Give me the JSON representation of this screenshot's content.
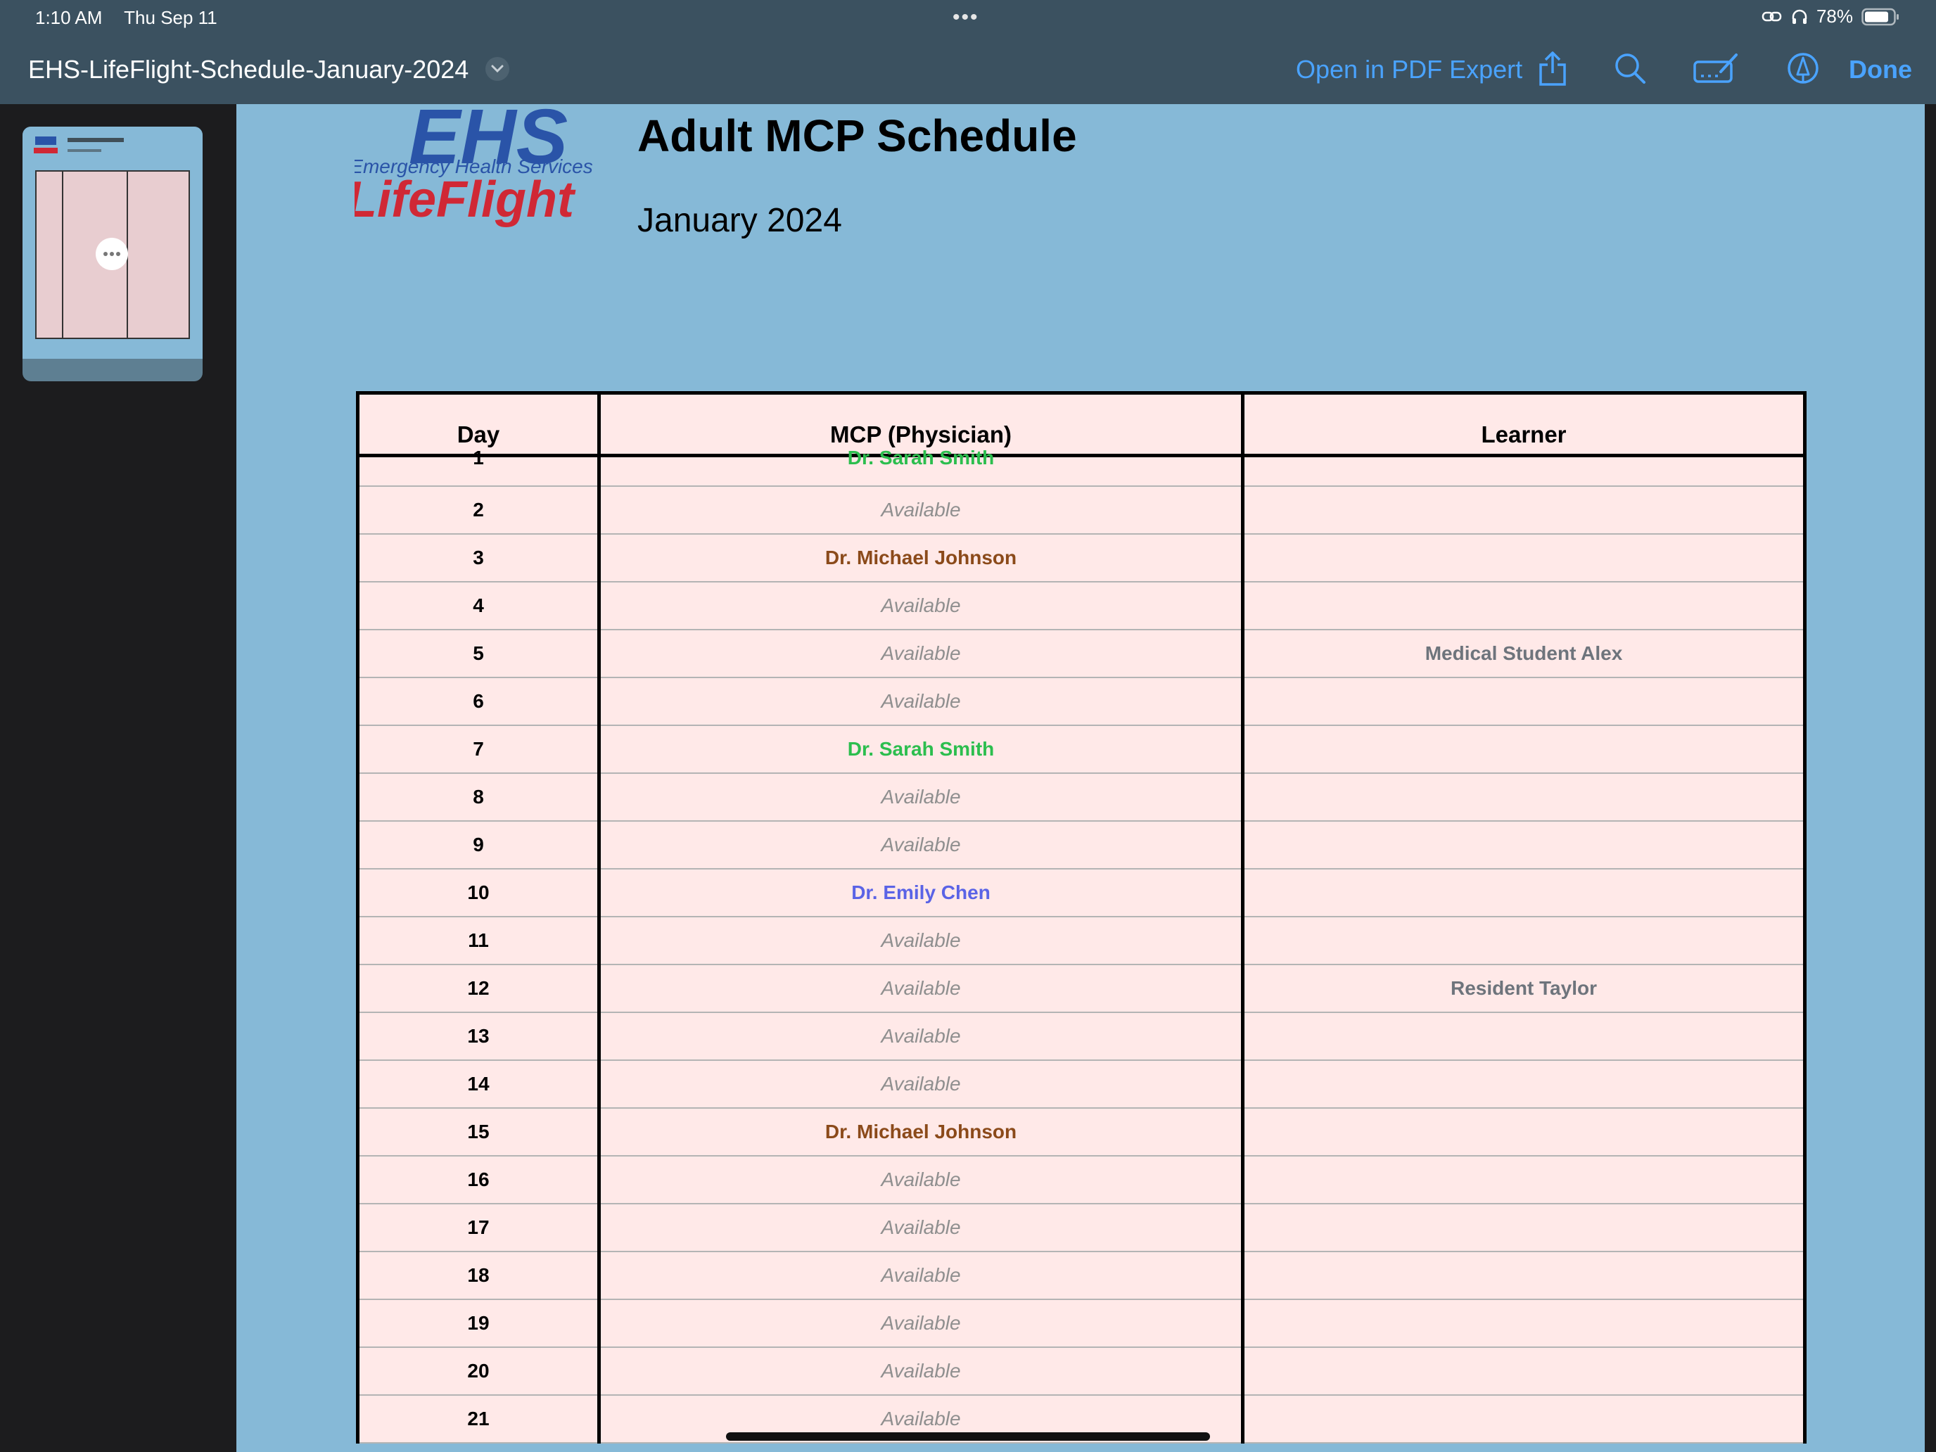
{
  "status_bar": {
    "time": "1:10 AM",
    "date": "Thu Sep 11",
    "battery": "78%",
    "icons": [
      "link-icon",
      "headphones-icon",
      "battery-icon"
    ]
  },
  "multitask_dots": "•••",
  "nav": {
    "document_title": "EHS-LifeFlight-Schedule-January-2024",
    "open_in": "Open in PDF Expert",
    "done": "Done",
    "icons": [
      "share-icon",
      "search-icon",
      "annotate-icon",
      "markup-icon"
    ],
    "accent": "#4aa3ff"
  },
  "logo": {
    "line1": "EHS",
    "line2": "Emergency Health Services",
    "line3": "LifeFlight",
    "blue": "#2a54a8",
    "red": "#d02835"
  },
  "document": {
    "title": "Adult MCP Schedule",
    "subtitle": "January 2024"
  },
  "table": {
    "headers": [
      "Day",
      "MCP (Physician)",
      "Learner"
    ],
    "rows": [
      {
        "day": "1",
        "mcp": "Dr. Sarah Smith",
        "type": "physician",
        "color": "#2cbe4e",
        "learner": ""
      },
      {
        "day": "2",
        "mcp": "Available",
        "type": "available",
        "learner": ""
      },
      {
        "day": "3",
        "mcp": "Dr. Michael Johnson",
        "type": "physician",
        "color": "#8b4a1a",
        "learner": ""
      },
      {
        "day": "4",
        "mcp": "Available",
        "type": "available",
        "learner": ""
      },
      {
        "day": "5",
        "mcp": "Available",
        "type": "available",
        "learner": "Medical Student Alex"
      },
      {
        "day": "6",
        "mcp": "Available",
        "type": "available",
        "learner": ""
      },
      {
        "day": "7",
        "mcp": "Dr. Sarah Smith",
        "type": "physician",
        "color": "#2cbe4e",
        "learner": ""
      },
      {
        "day": "8",
        "mcp": "Available",
        "type": "available",
        "learner": ""
      },
      {
        "day": "9",
        "mcp": "Available",
        "type": "available",
        "learner": ""
      },
      {
        "day": "10",
        "mcp": "Dr. Emily Chen",
        "type": "physician",
        "color": "#5a63e6",
        "learner": ""
      },
      {
        "day": "11",
        "mcp": "Available",
        "type": "available",
        "learner": ""
      },
      {
        "day": "12",
        "mcp": "Available",
        "type": "available",
        "learner": "Resident Taylor"
      },
      {
        "day": "13",
        "mcp": "Available",
        "type": "available",
        "learner": ""
      },
      {
        "day": "14",
        "mcp": "Available",
        "type": "available",
        "learner": ""
      },
      {
        "day": "15",
        "mcp": "Dr. Michael Johnson",
        "type": "physician",
        "color": "#8b4a1a",
        "learner": ""
      },
      {
        "day": "16",
        "mcp": "Available",
        "type": "available",
        "learner": ""
      },
      {
        "day": "17",
        "mcp": "Available",
        "type": "available",
        "learner": ""
      },
      {
        "day": "18",
        "mcp": "Available",
        "type": "available",
        "learner": ""
      },
      {
        "day": "19",
        "mcp": "Available",
        "type": "available",
        "learner": ""
      },
      {
        "day": "20",
        "mcp": "Available",
        "type": "available",
        "learner": ""
      },
      {
        "day": "21",
        "mcp": "Available",
        "type": "available",
        "learner": ""
      }
    ]
  }
}
